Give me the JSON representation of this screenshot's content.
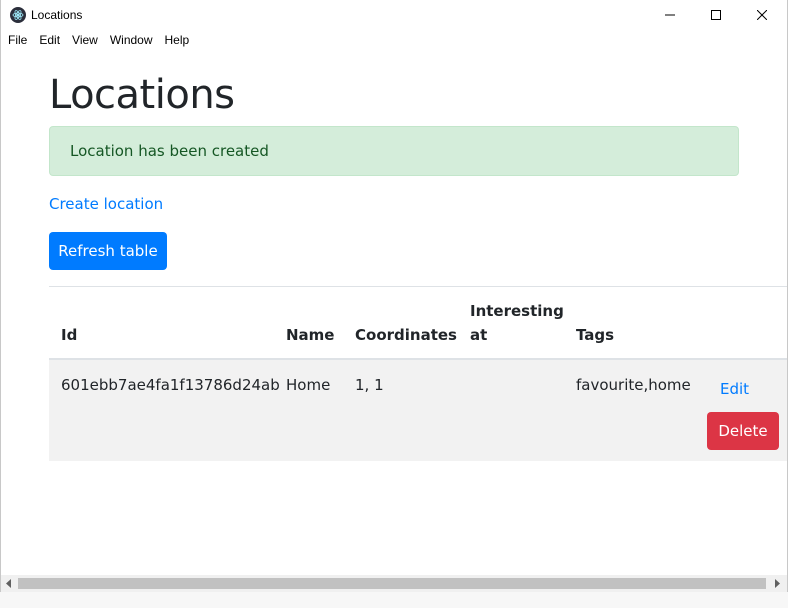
{
  "window": {
    "title": "Locations"
  },
  "menu": [
    "File",
    "Edit",
    "View",
    "Window",
    "Help"
  ],
  "page": {
    "title": "Locations",
    "alert": "Location has been created",
    "create_link": "Create location",
    "refresh_button": "Refresh table"
  },
  "table": {
    "headers": {
      "id": "Id",
      "name": "Name",
      "coordinates": "Coordinates",
      "interesting_1": "Interesting",
      "interesting_2": "at",
      "tags": "Tags"
    },
    "rows": [
      {
        "id": "601ebb7ae4fa1f13786d24ab",
        "name": "Home",
        "coordinates": "1, 1",
        "interesting_at": "",
        "tags": "favourite,home",
        "edit": "Edit",
        "delete": "Delete"
      }
    ]
  },
  "colors": {
    "primary": "#007bff",
    "danger": "#dc3545",
    "success_bg": "#d4edda",
    "success_text": "#155724"
  }
}
